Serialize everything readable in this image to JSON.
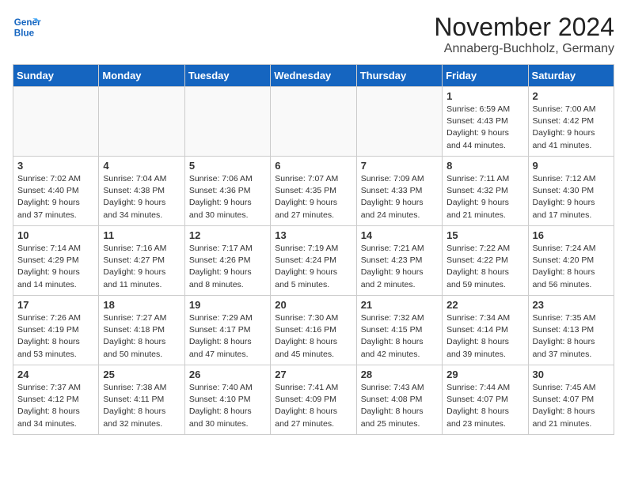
{
  "header": {
    "logo_line1": "General",
    "logo_line2": "Blue",
    "month": "November 2024",
    "location": "Annaberg-Buchholz, Germany"
  },
  "days_of_week": [
    "Sunday",
    "Monday",
    "Tuesday",
    "Wednesday",
    "Thursday",
    "Friday",
    "Saturday"
  ],
  "weeks": [
    [
      {
        "day": "",
        "info": ""
      },
      {
        "day": "",
        "info": ""
      },
      {
        "day": "",
        "info": ""
      },
      {
        "day": "",
        "info": ""
      },
      {
        "day": "",
        "info": ""
      },
      {
        "day": "1",
        "info": "Sunrise: 6:59 AM\nSunset: 4:43 PM\nDaylight: 9 hours and 44 minutes."
      },
      {
        "day": "2",
        "info": "Sunrise: 7:00 AM\nSunset: 4:42 PM\nDaylight: 9 hours and 41 minutes."
      }
    ],
    [
      {
        "day": "3",
        "info": "Sunrise: 7:02 AM\nSunset: 4:40 PM\nDaylight: 9 hours and 37 minutes."
      },
      {
        "day": "4",
        "info": "Sunrise: 7:04 AM\nSunset: 4:38 PM\nDaylight: 9 hours and 34 minutes."
      },
      {
        "day": "5",
        "info": "Sunrise: 7:06 AM\nSunset: 4:36 PM\nDaylight: 9 hours and 30 minutes."
      },
      {
        "day": "6",
        "info": "Sunrise: 7:07 AM\nSunset: 4:35 PM\nDaylight: 9 hours and 27 minutes."
      },
      {
        "day": "7",
        "info": "Sunrise: 7:09 AM\nSunset: 4:33 PM\nDaylight: 9 hours and 24 minutes."
      },
      {
        "day": "8",
        "info": "Sunrise: 7:11 AM\nSunset: 4:32 PM\nDaylight: 9 hours and 21 minutes."
      },
      {
        "day": "9",
        "info": "Sunrise: 7:12 AM\nSunset: 4:30 PM\nDaylight: 9 hours and 17 minutes."
      }
    ],
    [
      {
        "day": "10",
        "info": "Sunrise: 7:14 AM\nSunset: 4:29 PM\nDaylight: 9 hours and 14 minutes."
      },
      {
        "day": "11",
        "info": "Sunrise: 7:16 AM\nSunset: 4:27 PM\nDaylight: 9 hours and 11 minutes."
      },
      {
        "day": "12",
        "info": "Sunrise: 7:17 AM\nSunset: 4:26 PM\nDaylight: 9 hours and 8 minutes."
      },
      {
        "day": "13",
        "info": "Sunrise: 7:19 AM\nSunset: 4:24 PM\nDaylight: 9 hours and 5 minutes."
      },
      {
        "day": "14",
        "info": "Sunrise: 7:21 AM\nSunset: 4:23 PM\nDaylight: 9 hours and 2 minutes."
      },
      {
        "day": "15",
        "info": "Sunrise: 7:22 AM\nSunset: 4:22 PM\nDaylight: 8 hours and 59 minutes."
      },
      {
        "day": "16",
        "info": "Sunrise: 7:24 AM\nSunset: 4:20 PM\nDaylight: 8 hours and 56 minutes."
      }
    ],
    [
      {
        "day": "17",
        "info": "Sunrise: 7:26 AM\nSunset: 4:19 PM\nDaylight: 8 hours and 53 minutes."
      },
      {
        "day": "18",
        "info": "Sunrise: 7:27 AM\nSunset: 4:18 PM\nDaylight: 8 hours and 50 minutes."
      },
      {
        "day": "19",
        "info": "Sunrise: 7:29 AM\nSunset: 4:17 PM\nDaylight: 8 hours and 47 minutes."
      },
      {
        "day": "20",
        "info": "Sunrise: 7:30 AM\nSunset: 4:16 PM\nDaylight: 8 hours and 45 minutes."
      },
      {
        "day": "21",
        "info": "Sunrise: 7:32 AM\nSunset: 4:15 PM\nDaylight: 8 hours and 42 minutes."
      },
      {
        "day": "22",
        "info": "Sunrise: 7:34 AM\nSunset: 4:14 PM\nDaylight: 8 hours and 39 minutes."
      },
      {
        "day": "23",
        "info": "Sunrise: 7:35 AM\nSunset: 4:13 PM\nDaylight: 8 hours and 37 minutes."
      }
    ],
    [
      {
        "day": "24",
        "info": "Sunrise: 7:37 AM\nSunset: 4:12 PM\nDaylight: 8 hours and 34 minutes."
      },
      {
        "day": "25",
        "info": "Sunrise: 7:38 AM\nSunset: 4:11 PM\nDaylight: 8 hours and 32 minutes."
      },
      {
        "day": "26",
        "info": "Sunrise: 7:40 AM\nSunset: 4:10 PM\nDaylight: 8 hours and 30 minutes."
      },
      {
        "day": "27",
        "info": "Sunrise: 7:41 AM\nSunset: 4:09 PM\nDaylight: 8 hours and 27 minutes."
      },
      {
        "day": "28",
        "info": "Sunrise: 7:43 AM\nSunset: 4:08 PM\nDaylight: 8 hours and 25 minutes."
      },
      {
        "day": "29",
        "info": "Sunrise: 7:44 AM\nSunset: 4:07 PM\nDaylight: 8 hours and 23 minutes."
      },
      {
        "day": "30",
        "info": "Sunrise: 7:45 AM\nSunset: 4:07 PM\nDaylight: 8 hours and 21 minutes."
      }
    ]
  ]
}
